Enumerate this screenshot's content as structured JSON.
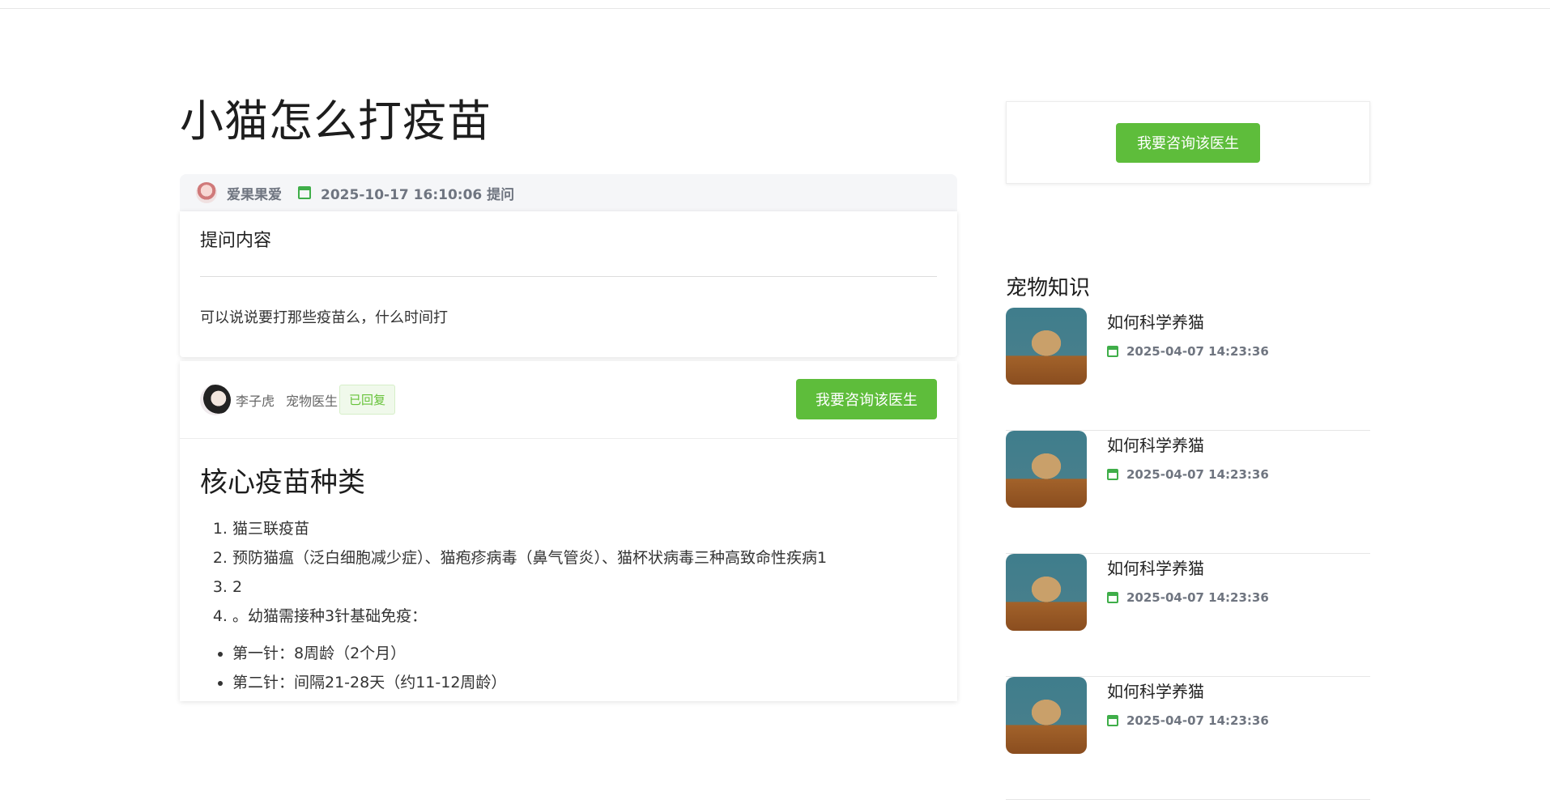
{
  "question": {
    "title": "小猫怎么打疫苗",
    "asker": "爱果果爱",
    "datetime": "2025-10-17 16:10:06 提问",
    "content_heading": "提问内容",
    "content": "可以说说要打那些疫苗么，什么时间打"
  },
  "answer": {
    "doctor_name": "李子虎",
    "doctor_title": "宠物医生",
    "status_badge": "已回复",
    "consult_button": "我要咨询该医生",
    "heading": "核心疫苗种类",
    "ordered_items": [
      "猫三联疫苗",
      "预防猫瘟（泛白细胞减少症）、猫疱疹病毒（鼻气管炎）、猫杯状病毒三种高致命性疾病1",
      "2",
      "。幼猫需接种3针基础免疫："
    ],
    "bullet_items": [
      "第一针：8周龄（2个月）",
      "第二针：间隔21-28天（约11-12周龄）"
    ]
  },
  "sidebar": {
    "consult_button": "我要咨询该医生",
    "section_title": "宠物知识",
    "articles": [
      {
        "title": "如何科学养猫",
        "date": "2025-04-07 14:23:36"
      },
      {
        "title": "如何科学养猫",
        "date": "2025-04-07 14:23:36"
      },
      {
        "title": "如何科学养猫",
        "date": "2025-04-07 14:23:36"
      },
      {
        "title": "如何科学养猫",
        "date": "2025-04-07 14:23:36"
      }
    ]
  },
  "colors": {
    "accent_green": "#5ebd3b",
    "calendar_green": "#3fae49",
    "badge_text": "#67c23a"
  }
}
